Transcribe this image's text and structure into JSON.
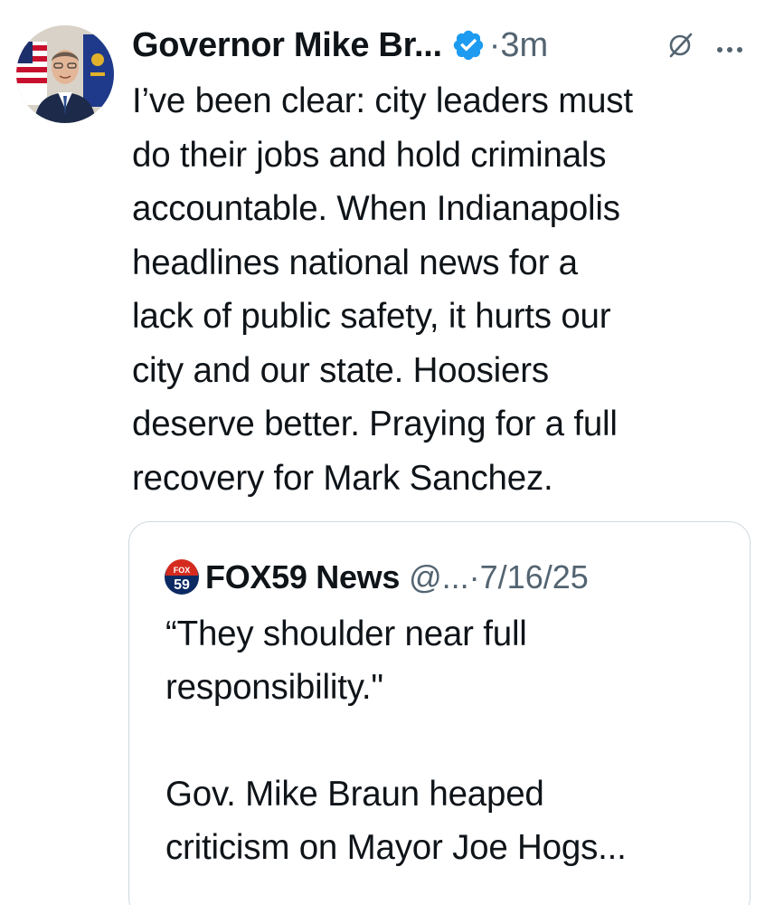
{
  "post": {
    "author_name": "Governor Mike Br...",
    "separator": "·",
    "time": "3m",
    "text_lines": [
      "I’ve been clear: city leaders must",
      "do their jobs and hold criminals",
      "accountable. When Indianapolis",
      "headlines national news for a",
      "lack of public safety, it hurts our",
      "city and our state. Hoosiers",
      "deserve better. Praying for a full",
      "recovery for Mark Sanchez."
    ]
  },
  "quoted": {
    "logo_top": "FOX",
    "logo_bottom": "59",
    "name": "FOX59 News",
    "handle": "@...",
    "separator": "·",
    "date": "7/16/25",
    "paragraph1_lines": [
      "“They shoulder near full",
      "responsibility.\""
    ],
    "paragraph2_lines": [
      "Gov. Mike Braun heaped",
      "criticism on Mayor Joe Hogs..."
    ]
  },
  "icons": {
    "verified": "verified-badge-icon",
    "grok": "grok-slash-icon",
    "more": "more-dots-icon"
  },
  "colors": {
    "verified_blue": "#1d9bf0",
    "secondary_text": "#536471",
    "border": "#cfd9de",
    "fox_red": "#d52b1e",
    "fox_blue": "#0b2a63"
  }
}
